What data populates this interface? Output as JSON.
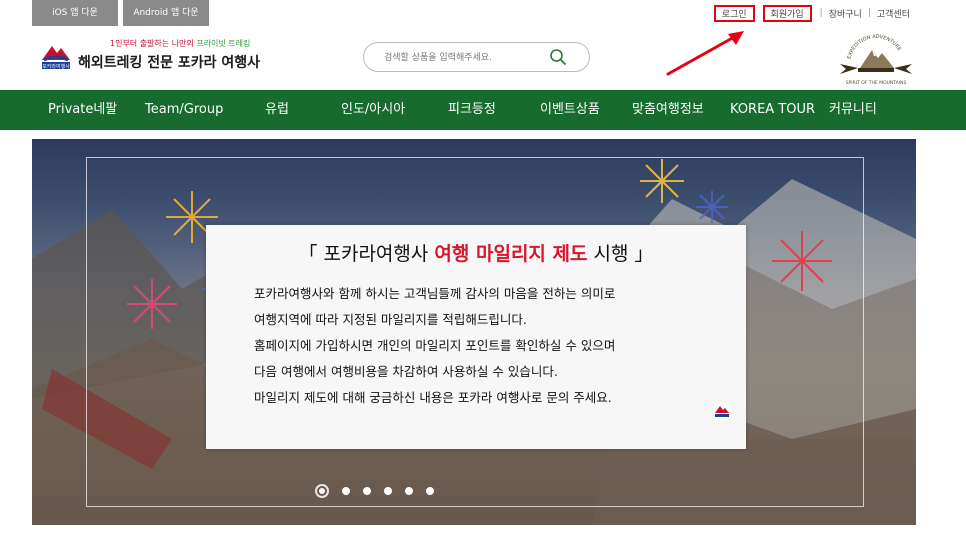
{
  "topbar": {
    "ios_label": "iOS 앱 다운",
    "android_label": "Android 앱 다운",
    "login_label": "로그인",
    "signup_label": "회원가입",
    "cart_label": "장바구니",
    "support_label": "고객센터",
    "separator": "|"
  },
  "header": {
    "logo_tagline_a": "1인부터 출발하는 나만의 ",
    "logo_tagline_b": "프라이빗 트레킹",
    "logo_title": "해외트레킹 전문 포카라 여행사",
    "search_placeholder": "검색할 상품을 입력해주세요.",
    "brand_top": "EXPEDITION ADVENTURE",
    "brand_bottom": "SPIRIT OF THE MOUNTAINS",
    "logo_mark_text": "포카라여행사"
  },
  "nav": {
    "items": [
      "Private네팔",
      "Team/Group",
      "유럽",
      "인도/아시아",
      "피크등정",
      "이벤트상품",
      "맞춤여행정보",
      "KOREA TOUR",
      "커뮤니티"
    ]
  },
  "banner": {
    "title_open": "「 포카라여행사 ",
    "title_highlight": "여행 마일리지 제도",
    "title_close": " 시행 」",
    "lines": [
      "포카라여행사와 함께 하시는 고객님들께 감사의 마음을 전하는 의미로",
      "여행지역에 따라 지정된 마일리지를 적립해드립니다.",
      "홈페이지에 가입하시면 개인의 마일리지 포인트를 확인하실 수 있으며",
      "다음 여행에서 여행비용을 차감하여 사용하실 수 있습니다.",
      "마일리지 제도에 대해 궁금하신 내용은 포카라 여행사로 문의 주세요."
    ],
    "slide_count": 6,
    "active_slide": 1
  },
  "colors": {
    "nav_bg": "#176b2c",
    "highlight": "#d9142b",
    "annotation": "#e60012"
  }
}
